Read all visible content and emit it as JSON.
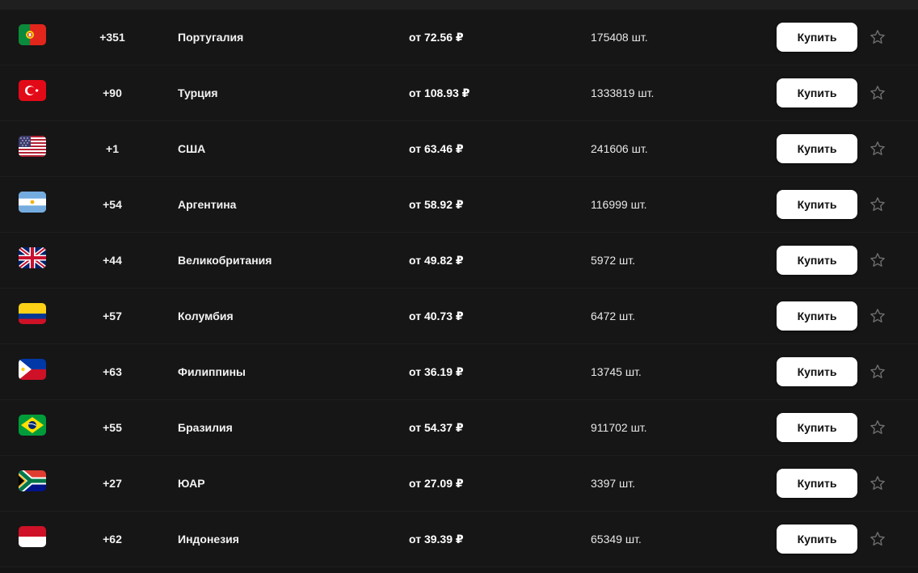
{
  "colors": {
    "background": "#141414",
    "row_background": "#161616",
    "divider": "#1e1e1e",
    "button_bg": "#ffffff",
    "button_text": "#111111",
    "star": "#6e6e6e"
  },
  "rows": [
    {
      "flag_icon": "portugal-flag-icon",
      "code": "+351",
      "country": "Португалия",
      "price": "от 72.56 ₽",
      "qty": "175408 шт.",
      "buy_label": "Купить"
    },
    {
      "flag_icon": "turkey-flag-icon",
      "code": "+90",
      "country": "Турция",
      "price": "от 108.93 ₽",
      "qty": "1333819 шт.",
      "buy_label": "Купить"
    },
    {
      "flag_icon": "usa-flag-icon",
      "code": "+1",
      "country": "США",
      "price": "от 63.46 ₽",
      "qty": "241606 шт.",
      "buy_label": "Купить"
    },
    {
      "flag_icon": "argentina-flag-icon",
      "code": "+54",
      "country": "Аргентина",
      "price": "от 58.92 ₽",
      "qty": "116999 шт.",
      "buy_label": "Купить"
    },
    {
      "flag_icon": "uk-flag-icon",
      "code": "+44",
      "country": "Великобритания",
      "price": "от 49.82 ₽",
      "qty": "5972 шт.",
      "buy_label": "Купить"
    },
    {
      "flag_icon": "colombia-flag-icon",
      "code": "+57",
      "country": "Колумбия",
      "price": "от 40.73 ₽",
      "qty": "6472 шт.",
      "buy_label": "Купить"
    },
    {
      "flag_icon": "philippines-flag-icon",
      "code": "+63",
      "country": "Филиппины",
      "price": "от 36.19 ₽",
      "qty": "13745 шт.",
      "buy_label": "Купить"
    },
    {
      "flag_icon": "brazil-flag-icon",
      "code": "+55",
      "country": "Бразилия",
      "price": "от 54.37 ₽",
      "qty": "911702 шт.",
      "buy_label": "Купить"
    },
    {
      "flag_icon": "south-africa-flag-icon",
      "code": "+27",
      "country": "ЮАР",
      "price": "от 27.09 ₽",
      "qty": "3397 шт.",
      "buy_label": "Купить"
    },
    {
      "flag_icon": "indonesia-flag-icon",
      "code": "+62",
      "country": "Индонезия",
      "price": "от 39.39 ₽",
      "qty": "65349 шт.",
      "buy_label": "Купить"
    }
  ]
}
